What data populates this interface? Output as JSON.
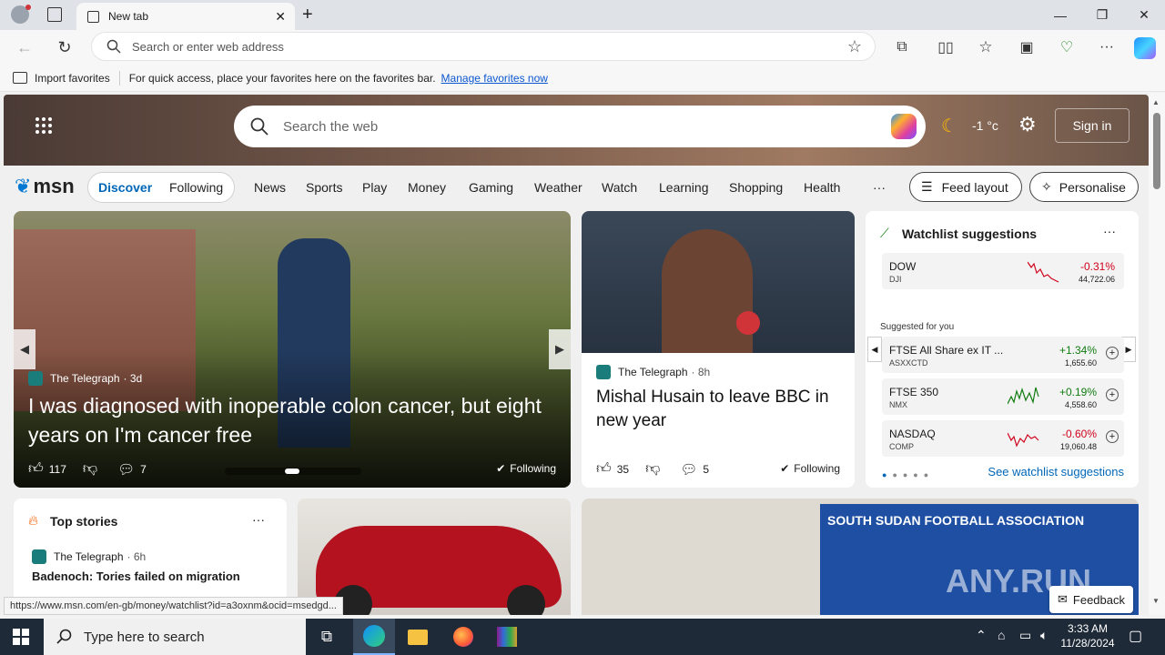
{
  "browser": {
    "tab_title": "New tab",
    "address_placeholder": "Search or enter web address",
    "favorites_bar": {
      "import_label": "Import favorites",
      "hint": "For quick access, place your favorites here on the favorites bar.",
      "manage_link": "Manage favorites now"
    },
    "status_url": "https://www.msn.com/en-gb/money/watchlist?id=a3oxnm&ocid=msedgd..."
  },
  "msn": {
    "search_placeholder": "Search the web",
    "weather": "-1 °c",
    "signin": "Sign in",
    "logo_text": "msn",
    "nav": {
      "discover": "Discover",
      "following": "Following",
      "items": [
        "News",
        "Sports",
        "Play",
        "Money",
        "Gaming",
        "Weather",
        "Watch",
        "Learning",
        "Shopping",
        "Health"
      ],
      "more": "···",
      "feed_layout": "Feed layout",
      "personalise": "Personalise"
    },
    "main_story": {
      "source": "The Telegraph",
      "age": "· 3d",
      "headline": "I was diagnosed with inoperable colon cancer, but eight years on I'm cancer free",
      "likes": "117",
      "comments": "7",
      "following": "Following"
    },
    "second_story": {
      "source": "The Telegraph",
      "age": "· 8h",
      "headline": "Mishal Husain to leave BBC in new year",
      "likes": "35",
      "comments": "5",
      "following": "Following"
    },
    "watchlist": {
      "title": "Watchlist suggestions",
      "more": "···",
      "suggested_label": "Suggested for you",
      "see_more": "See watchlist suggestions",
      "rows": [
        {
          "name": "DOW",
          "ticker": "DJI",
          "change": "-0.31%",
          "price": "44,722.06",
          "color": "#d0021b"
        },
        {
          "name": "FTSE All Share ex IT ...",
          "ticker": "ASXXCTD",
          "change": "+1.34%",
          "price": "1,655.60",
          "color": "#107c10"
        },
        {
          "name": "FTSE 350",
          "ticker": "NMX",
          "change": "+0.19%",
          "price": "4,558.60",
          "color": "#107c10"
        },
        {
          "name": "NASDAQ",
          "ticker": "COMP",
          "change": "-0.60%",
          "price": "19,060.48",
          "color": "#d0021b"
        }
      ]
    },
    "top_stories": {
      "title": "Top stories",
      "more": "···",
      "source": "The Telegraph",
      "age": "· 6h",
      "headline": "Badenoch: Tories failed on migration"
    },
    "promo_banner": "SOUTH SUDAN FOOTBALL ASSOCIATION",
    "feedback": "Feedback",
    "watermark": "ANY.RUN"
  },
  "taskbar": {
    "search_placeholder": "Type here to search",
    "time": "3:33 AM",
    "date": "11/28/2024"
  }
}
